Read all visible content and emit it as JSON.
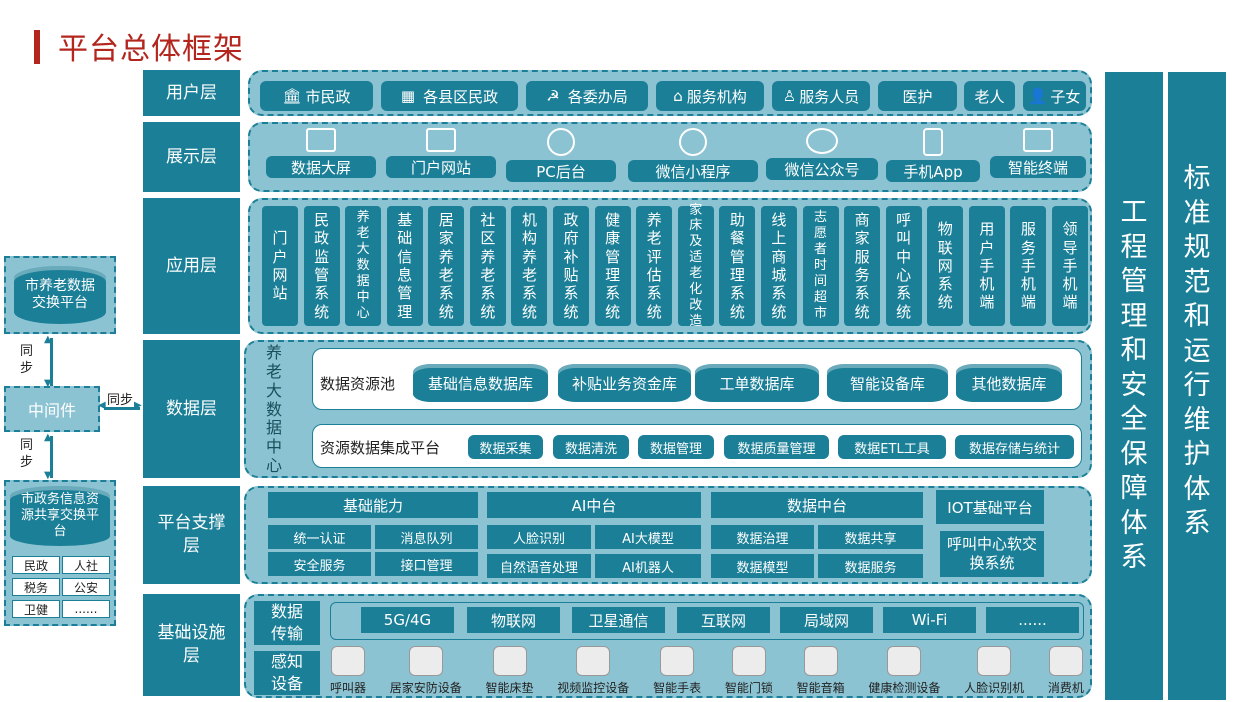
{
  "title": "平台总体框架",
  "layers": {
    "user": "用户层",
    "display": "展示层",
    "app": "应用层",
    "data": "数据层",
    "support": "平台支撑层",
    "infra": "基础设施层"
  },
  "users": [
    "市民政",
    "各县区民政",
    "各委办局",
    "服务机构",
    "服务人员",
    "医护",
    "老人",
    "子女"
  ],
  "displays": [
    "数据大屏",
    "门户网站",
    "PC后台",
    "微信小程序",
    "微信公众号",
    "手机App",
    "智能终端"
  ],
  "apps": [
    "门户网站",
    "民政监管系统",
    "养老大数据中心",
    "基础信息管理",
    "居家养老系统",
    "社区养老系统",
    "机构养老系统",
    "政府补贴系统",
    "健康管理系统",
    "养老评估系统",
    "家床及适老化改造",
    "助餐管理系统",
    "线上商城系统",
    "志愿者时间超市",
    "商家服务系统",
    "呼叫中心系统",
    "物联网系统",
    "用户手机端",
    "服务手机端",
    "领导手机端"
  ],
  "data_layer": {
    "center": "养老大数据中心",
    "pool_label": "数据资源池",
    "pool": [
      "基础信息数据库",
      "补贴业务资金库",
      "工单数据库",
      "智能设备库",
      "其他数据库"
    ],
    "integ_label": "资源数据集成平台",
    "integ": [
      "数据采集",
      "数据清洗",
      "数据管理",
      "数据质量管理",
      "数据ETL工具",
      "数据存储与统计"
    ]
  },
  "support": {
    "basic": {
      "title": "基础能力",
      "items": [
        "统一认证",
        "消息队列",
        "安全服务",
        "接口管理"
      ]
    },
    "ai": {
      "title": "AI中台",
      "items": [
        "人脸识别",
        "AI大模型",
        "自然语音处理",
        "AI机器人"
      ]
    },
    "data": {
      "title": "数据中台",
      "items": [
        "数据治理",
        "数据共享",
        "数据模型",
        "数据服务"
      ]
    },
    "iot": "IOT基础平台",
    "call": "呼叫中心软交换系统"
  },
  "infra": {
    "trans_label": "数据传输",
    "trans": [
      "5G/4G",
      "物联网",
      "卫星通信",
      "互联网",
      "局域网",
      "Wi-Fi",
      "......"
    ],
    "sense_label": "感知设备",
    "sense": [
      "呼叫器",
      "居家安防设备",
      "智能床垫",
      "视频监控设备",
      "智能手表",
      "智能门锁",
      "智能音箱",
      "健康检测设备",
      "人脸识别机",
      "消费机"
    ]
  },
  "right": {
    "eng": "工程管理和安全保障体系",
    "std": "标准规范和运行维护体系"
  },
  "left": {
    "exchange": "市养老数据交换平台",
    "sync1": "同步",
    "middleware": "中间件",
    "sync_h": "同步",
    "sync2": "同步",
    "gov": "市政务信息资源共享交换平台",
    "gov_items": [
      "民政",
      "人社",
      "税务",
      "公安",
      "卫健",
      "......"
    ]
  },
  "colors": {
    "primary": "#1a7f97",
    "light": "#8cc3d2",
    "title": "#b3261e"
  }
}
